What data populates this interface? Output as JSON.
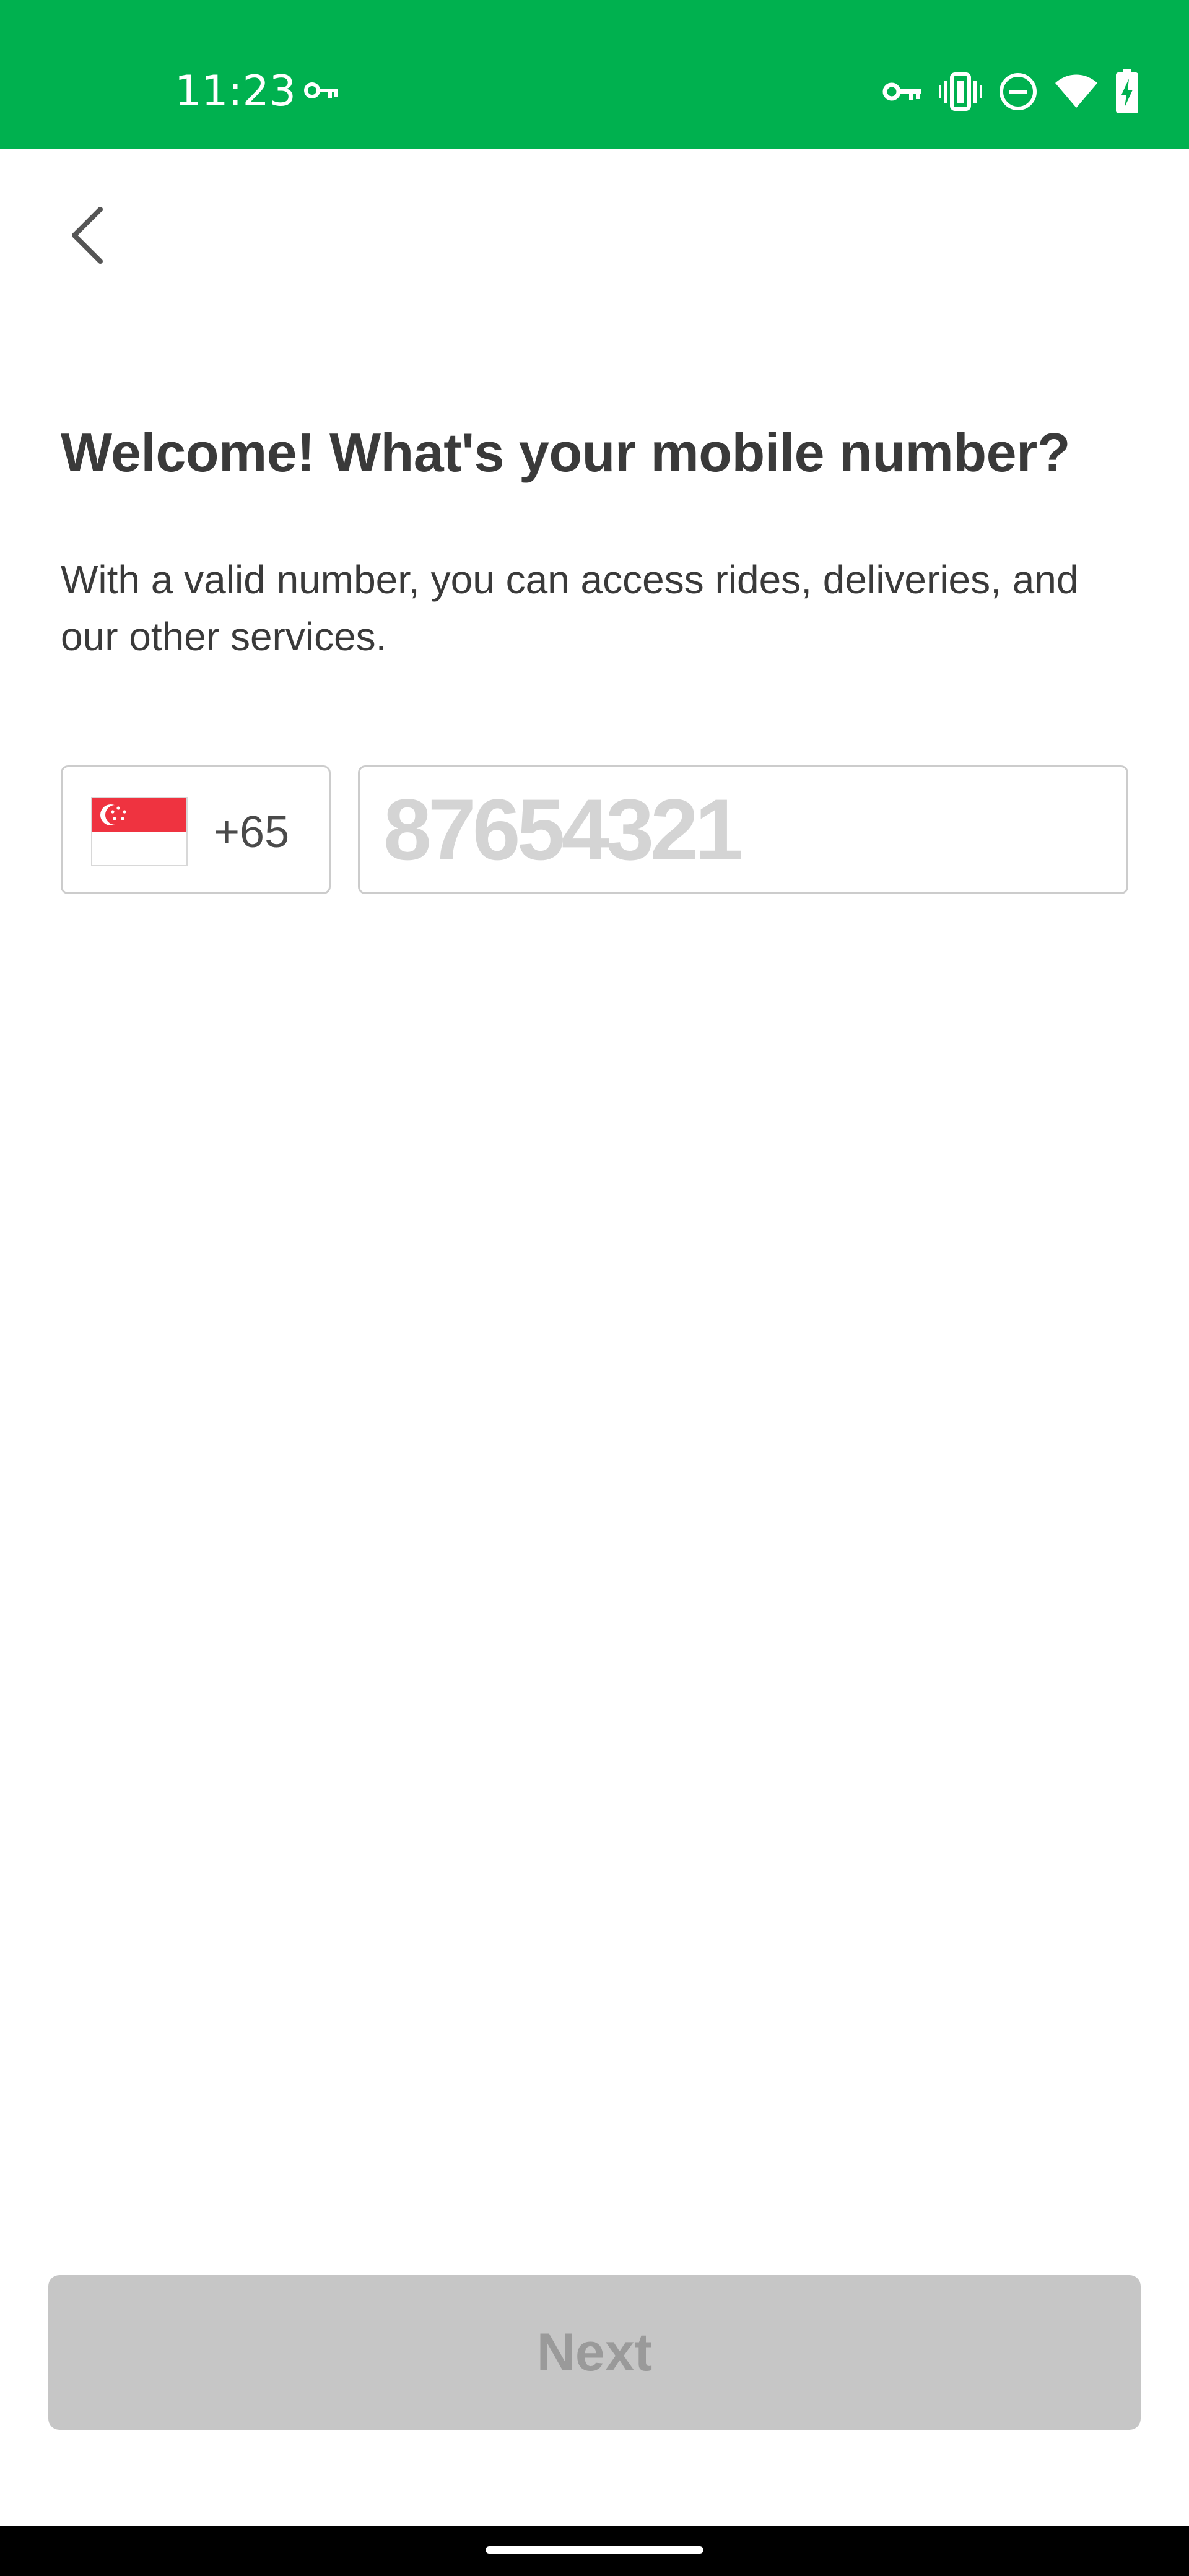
{
  "status_bar": {
    "time": "11:23",
    "background": "#00b14f",
    "icons": [
      "key-icon",
      "vpn-key-icon",
      "vibrate-icon",
      "do-not-disturb-icon",
      "wifi-icon",
      "battery-charging-icon"
    ]
  },
  "header": {
    "back_icon": "chevron-left-icon"
  },
  "main": {
    "title": "Welcome! What's your mobile number?",
    "subtitle": "With a valid number, you can access rides, deliveries, and our other services."
  },
  "phone_form": {
    "country_flag": "singapore-flag-icon",
    "dial_code": "+65",
    "phone_value": "",
    "phone_placeholder": "87654321"
  },
  "footer": {
    "next_label": "Next",
    "next_enabled": false
  },
  "colors": {
    "brand_green": "#00b14f",
    "text_dark": "#3a3a3a",
    "button_disabled_bg": "#c6c6c6",
    "button_disabled_text": "#9a9a9a"
  }
}
